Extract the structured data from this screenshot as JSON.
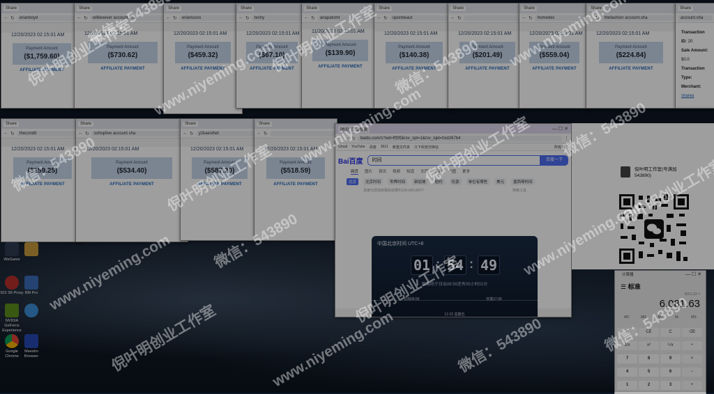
{
  "browser_windows": [
    {
      "tab": "Share",
      "url": "erianboyd",
      "date": "12/20/2023   02:15:01 AM",
      "label": "Payment Amount",
      "amount": "($1,759.60)",
      "aff": "AFFILIATE PAYMENT"
    },
    {
      "tab": "Share",
      "url": "willieoever   account.sha",
      "date": "12/20/2023   02:15:01 AM",
      "label": "Payment Amount",
      "amount": "($730.62)",
      "aff": "AFFILIATE PAYMENT"
    },
    {
      "tab": "Share",
      "url": "erianlusvo",
      "date": "12/20/2023   02:15:01 AM",
      "label": "Payment Amount",
      "amount": "($459.32)",
      "aff": "AFFILIATE PAYMENT"
    },
    {
      "tab": "Share",
      "url": "techy",
      "date": "12/20/2023   02:15:01 AM",
      "label": "Payment Amount",
      "amount": "($67.10)",
      "aff": "AFFILIATE PAYMENT"
    },
    {
      "tab": "Share",
      "url": "anapatomt",
      "date": "11/20/2023   02:15:01 AM",
      "label": "Payment Amount",
      "amount": "($139.90)",
      "aff": "AFFILIATE PAYMENT"
    },
    {
      "tab": "Share",
      "url": "uponbeaut",
      "date": "12/20/2023   02:15:01 AM",
      "label": "Payment Amount",
      "amount": "($140.38)",
      "aff": "AFFILIATE PAYMENT"
    },
    {
      "tab": "Share",
      "url": "",
      "date": "12/20/2023   02:15:01 AM",
      "label": "Payment Amount",
      "amount": "($201.49)",
      "aff": "AFFILIATE PAYMENT"
    },
    {
      "tab": "Share",
      "url": "homedec",
      "date": "12/20/2023   02:15:01 AM",
      "label": "Payment Amount",
      "amount": "($559.04)",
      "aff": "AFFILIATE PAYMENT"
    },
    {
      "tab": "Share",
      "url": "thefashion   account.sha",
      "date": "12/20/2023   02:15:01 AM",
      "label": "Payment Amount",
      "amount": "($224.84)",
      "aff": "AFFILIATE PAYMENT"
    },
    {
      "tab": "Share",
      "url": "thecondit",
      "date": "12/20/2023   02:15:01 AM",
      "label": "Payment Amount",
      "amount": "($159.25)",
      "aff": "AFFILIATE PAYMENT"
    },
    {
      "tab": "Share",
      "url": "oshoplive   account.sha",
      "date": "12/20/2023   02:15:01 AM",
      "label": "Payment Amount",
      "amount": "($534.40)",
      "aff": "AFFILIATE PAYMENT"
    },
    {
      "tab": "Share",
      "url": "y2kaesthet",
      "date": "12/20/2023   02:15:01 AM",
      "label": "Payment Amount",
      "amount": "($587.20)",
      "aff": "AFFILIATE PAYMENT"
    },
    {
      "tab": "Share",
      "url": "",
      "date": "12/20/2023   02:15:01 AM",
      "label": "Payment Amount",
      "amount": "($518.59)",
      "aff": "AFFILIATE PAYMENT"
    }
  ],
  "txn_panel": {
    "id_label": "Transaction ID:",
    "id_value": "20",
    "sale_label": "Sale Amount:",
    "sale_value": "$0.0",
    "type_label": "Transaction Type:",
    "merchant_label": "Merchant:",
    "merchant_value": "sharea"
  },
  "baidu": {
    "tab_title": "时间_百度搜索",
    "url": "baidu.com/s?wd=时间&rsv_spt=1&rsv_iqid=0xd267b4",
    "bookmarks": [
      "Gmail",
      "YouTube",
      "百度",
      "3621",
      "新建文件夹",
      "江下科技交换站",
      "所有书签"
    ],
    "logo": "Bai百度",
    "query": "时间",
    "search_button": "百度一下",
    "nav": [
      "网页",
      "图片",
      "资讯",
      "视频",
      "知道",
      "文库",
      "采购",
      "地图",
      "更多"
    ],
    "sub": [
      "北京",
      "北京时间",
      "世界时间",
      "新加坡",
      "纽约",
      "伦敦",
      "单位有哪些",
      "美元",
      "墨西哥时间"
    ],
    "result_count": "百度为您找到相关结果约100,000,000个",
    "search_tools": "搜索工具",
    "clock_title": "中国北京时间 UTC+8",
    "hh": "01",
    "mm": "54",
    "ss": "49",
    "clock_sub": "距离除夕日出06:56还有05小时01分",
    "sunrise": "日出06:56",
    "sunset": "日落17:09",
    "date_line": "12-22 星期五"
  },
  "watermarks": {
    "line1": "倪叶明创业工作室",
    "line2": "微信：543890",
    "line3": "www.niyeming.com"
  },
  "qr_profile": {
    "name": "倪叶明工作室(号满加",
    "id": "543890)"
  },
  "calculator": {
    "title": "计算器",
    "mode": "标准",
    "expression": "6061.63 =",
    "display": "6,081.63",
    "memory": [
      "MC",
      "MR",
      "M+",
      "M-",
      "MS"
    ],
    "keys": [
      [
        "%",
        "CE",
        "C",
        "⌫"
      ],
      [
        "1/x",
        "x²",
        "²√x",
        "÷"
      ],
      [
        "7",
        "8",
        "9",
        "×"
      ],
      [
        "4",
        "5",
        "6",
        "−"
      ],
      [
        "1",
        "2",
        "3",
        "+"
      ]
    ]
  },
  "desktop_icons": [
    "WeGame",
    "",
    "922 S5 Proxy",
    "",
    "NVIDIA GeForce Experience",
    "",
    "Google Chrome",
    "Maestro Browser",
    "BM Pro"
  ]
}
